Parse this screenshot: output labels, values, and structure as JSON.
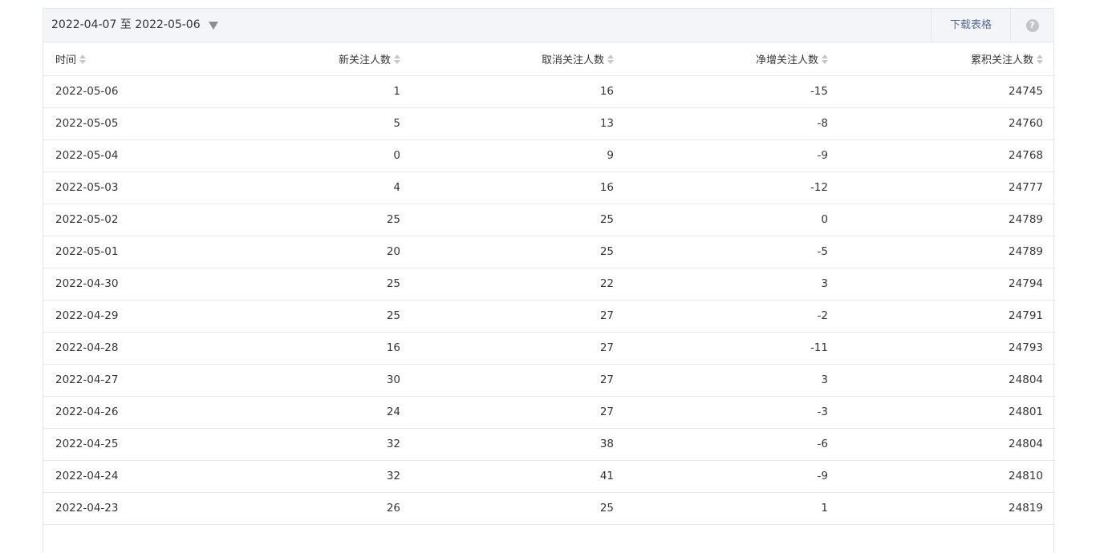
{
  "toolbar": {
    "date_range": "2022-04-07 至 2022-05-06",
    "download_label": "下载表格",
    "help_label": "?"
  },
  "table": {
    "columns": [
      "时间",
      "新关注人数",
      "取消关注人数",
      "净增关注人数",
      "累积关注人数"
    ],
    "rows": [
      [
        "2022-05-06",
        "1",
        "16",
        "-15",
        "24745"
      ],
      [
        "2022-05-05",
        "5",
        "13",
        "-8",
        "24760"
      ],
      [
        "2022-05-04",
        "0",
        "9",
        "-9",
        "24768"
      ],
      [
        "2022-05-03",
        "4",
        "16",
        "-12",
        "24777"
      ],
      [
        "2022-05-02",
        "25",
        "25",
        "0",
        "24789"
      ],
      [
        "2022-05-01",
        "20",
        "25",
        "-5",
        "24789"
      ],
      [
        "2022-04-30",
        "25",
        "22",
        "3",
        "24794"
      ],
      [
        "2022-04-29",
        "25",
        "27",
        "-2",
        "24791"
      ],
      [
        "2022-04-28",
        "16",
        "27",
        "-11",
        "24793"
      ],
      [
        "2022-04-27",
        "30",
        "27",
        "3",
        "24804"
      ],
      [
        "2022-04-26",
        "24",
        "27",
        "-3",
        "24801"
      ],
      [
        "2022-04-25",
        "32",
        "38",
        "-6",
        "24804"
      ],
      [
        "2022-04-24",
        "32",
        "41",
        "-9",
        "24810"
      ],
      [
        "2022-04-23",
        "26",
        "25",
        "1",
        "24819"
      ]
    ]
  },
  "colors": {
    "link": "#576b95",
    "border": "#e7e7eb",
    "toolbar_bg": "#f4f5f9",
    "text": "#353535"
  }
}
